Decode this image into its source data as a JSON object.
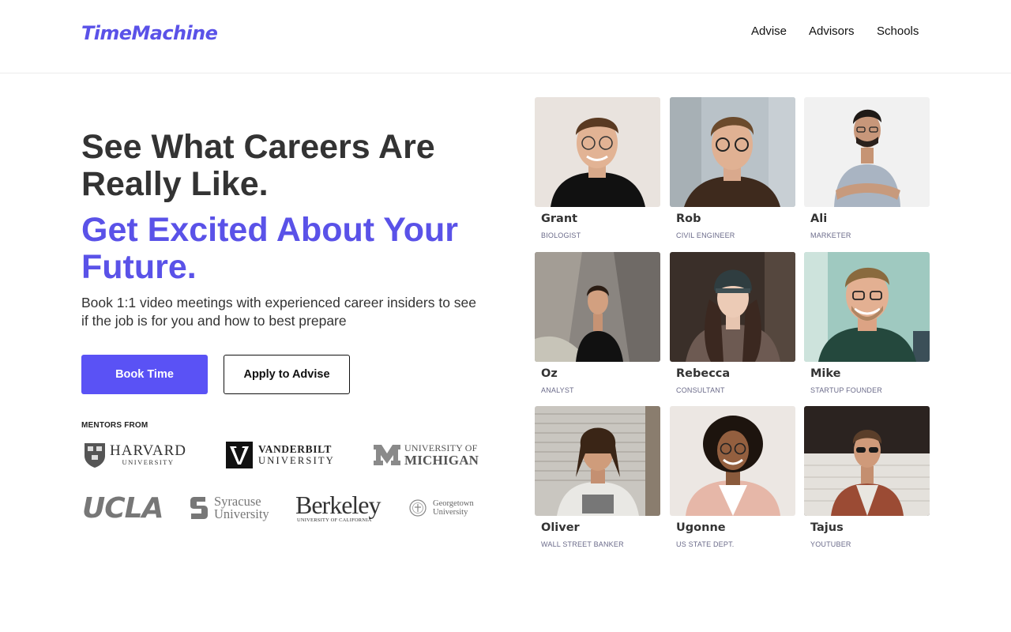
{
  "brand": {
    "logo": "TimeMachine",
    "accent": "#5a52e8"
  },
  "nav": [
    {
      "label": "Advise"
    },
    {
      "label": "Advisors"
    },
    {
      "label": "Schools"
    }
  ],
  "hero": {
    "title": "See What Careers Are Really Like.",
    "subtitle": "Get Excited About Your Future.",
    "description": "Book 1:1 video meetings with experienced career insiders to see if the job is for you and how to best prepare",
    "primary_button": "Book Time",
    "secondary_button": "Apply to Advise"
  },
  "mentors": {
    "label": "MENTORS FROM",
    "harvard": {
      "line1": "HARVARD",
      "line2": "UNIVERSITY"
    },
    "vanderbilt": {
      "line1": "VANDERBILT",
      "line2": "UNIVERSITY"
    },
    "michigan": {
      "line1": "UNIVERSITY OF",
      "line2": "MICHIGAN"
    },
    "ucla": {
      "line1": "UCLA"
    },
    "syracuse": {
      "line1": "Syracuse",
      "line2": "University"
    },
    "berkeley": {
      "line1": "Berkeley",
      "line2": "UNIVERSITY OF CALIFORNIA"
    },
    "georgetown": {
      "line1": "Georgetown",
      "line2": "University"
    }
  },
  "advisors": [
    {
      "name": "Grant",
      "role": "BIOLOGIST"
    },
    {
      "name": "Rob",
      "role": "CIVIL ENGINEER"
    },
    {
      "name": "Ali",
      "role": "MARKETER"
    },
    {
      "name": "Oz",
      "role": "ANALYST"
    },
    {
      "name": "Rebecca",
      "role": "CONSULTANT"
    },
    {
      "name": "Mike",
      "role": "STARTUP FOUNDER"
    },
    {
      "name": "Oliver",
      "role": "WALL STREET BANKER"
    },
    {
      "name": "Ugonne",
      "role": "US STATE DEPT."
    },
    {
      "name": "Tajus",
      "role": "YOUTUBER"
    }
  ]
}
